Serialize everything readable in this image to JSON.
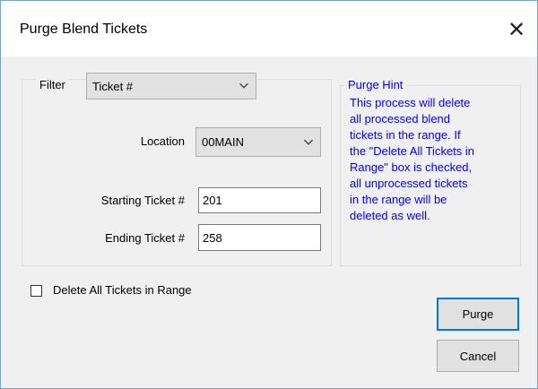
{
  "window": {
    "title": "Purge Blend Tickets",
    "close_icon": "close-icon"
  },
  "filter": {
    "label": "Filter",
    "selected": "Ticket #"
  },
  "location": {
    "label": "Location",
    "selected": "00MAIN"
  },
  "starting_ticket": {
    "label": "Starting Ticket #",
    "value": "201"
  },
  "ending_ticket": {
    "label": "Ending Ticket #",
    "value": "258"
  },
  "hint": {
    "title": "Purge Hint",
    "lines": [
      "This process will delete",
      "all processed blend",
      "tickets in the range.  If",
      "the \"Delete All Tickets in",
      "Range\" box is checked,",
      "all unprocessed tickets",
      "in the range will be",
      "deleted as well."
    ]
  },
  "delete_all": {
    "label": "Delete All Tickets in Range",
    "checked": false
  },
  "buttons": {
    "purge": "Purge",
    "cancel": "Cancel"
  },
  "colors": {
    "hint_text": "#0000ff",
    "default_button_border": "#0078d7"
  }
}
